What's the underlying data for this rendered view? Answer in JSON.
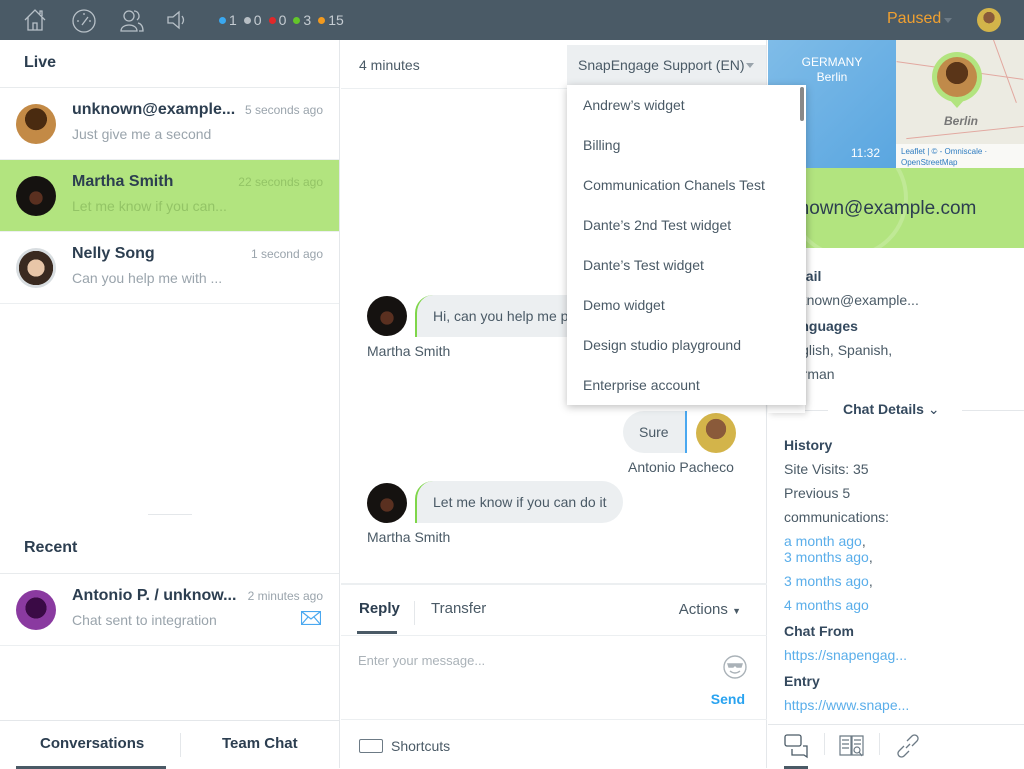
{
  "topbar": {
    "icons": [
      "home-icon",
      "dashboard-icon",
      "users-icon",
      "speaker-icon"
    ],
    "counters": [
      {
        "color": "#3aa8f0",
        "value": "1"
      },
      {
        "color": "#b7bec4",
        "value": "0"
      },
      {
        "color": "#e0282a",
        "value": "0"
      },
      {
        "color": "#63c62a",
        "value": "3"
      },
      {
        "color": "#f39a1e",
        "value": "15"
      }
    ],
    "status": "Paused"
  },
  "live": {
    "title": "Live",
    "conversations": [
      {
        "name": "unknown@example...",
        "time": "5 seconds ago",
        "message": "Just give me a second",
        "active": false
      },
      {
        "name": "Martha Smith",
        "time": "22 seconds ago",
        "message": "Let me know if you can...",
        "active": true
      },
      {
        "name": "Nelly Song",
        "time": "1 second ago",
        "message": "Can you help me with ...",
        "active": false
      }
    ]
  },
  "recent": {
    "title": "Recent",
    "conversations": [
      {
        "name": "Antonio P. / unknow...",
        "time": "2 minutes ago",
        "message": "Chat sent to integration"
      }
    ]
  },
  "bottom_tabs": {
    "conversations": "Conversations",
    "team_chat": "Team Chat"
  },
  "chat": {
    "duration": "4 minutes",
    "widget_selected": "SnapEngage Support (EN)",
    "widget_options": [
      "Andrew’s widget",
      "Billing",
      "Communication Chanels Test",
      "Dante’s 2nd Test widget",
      "Dante’s Test widget",
      "Demo widget",
      "Design studio playground",
      "Enterprise account"
    ],
    "messages": [
      {
        "sender": "Martha Smith",
        "text": "Hi, can you help me please?",
        "direction": "in"
      },
      {
        "sender": "Antonio Pacheco",
        "text": "Sure",
        "direction": "out"
      },
      {
        "sender": "Martha Smith",
        "text": "Let me know if you can do it",
        "direction": "in"
      }
    ]
  },
  "reply": {
    "tab_reply": "Reply",
    "tab_transfer": "Transfer",
    "actions": "Actions",
    "placeholder": "Enter your message...",
    "send": "Send",
    "shortcuts": "Shortcuts"
  },
  "visitor": {
    "country": "GERMANY",
    "city": "Berlin",
    "local_time": "11:32",
    "map_city": "Berlin",
    "map_attribution": "Leaflet | © - Omniscale · OpenStreetMap",
    "email_header": "unknown@example.com",
    "email_label": "Email",
    "email_value": "unknown@example...",
    "languages_label": "Languages",
    "languages_line1": "English, Spanish,",
    "languages_line2": "German",
    "details_toggle": "Chat Details",
    "history_label": "History",
    "site_visits": "Site Visits: 35",
    "previous_line1": "Previous 5",
    "previous_line2": "communications:",
    "history_links": [
      "a month ago",
      "3 months ago",
      "3 months ago",
      "4 months ago"
    ],
    "chat_from_label": "Chat From",
    "chat_from_value": "https://snapengag...",
    "entry_label": "Entry",
    "entry_value": "https://www.snape..."
  },
  "right_tabs": [
    "chat-icon",
    "knowledge-base-icon",
    "link-icon"
  ]
}
